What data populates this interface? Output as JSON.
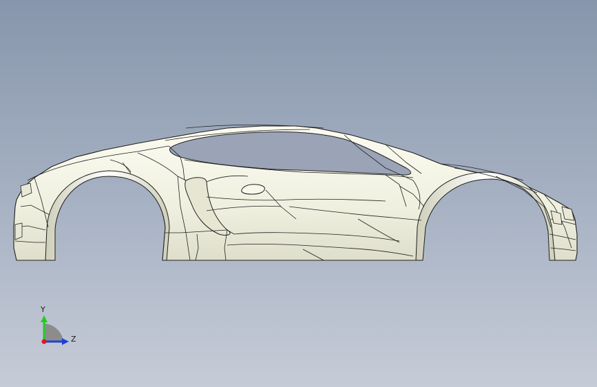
{
  "viewport": {
    "background_top": "#8796ac",
    "background_bottom": "#c6ccd7"
  },
  "model": {
    "surface_color": "#f2f2e4",
    "edge_color": "#1e1e1e",
    "shadow_color": "#b9baa6"
  },
  "triad": {
    "y_label": "Y",
    "z_label": "Z",
    "y_color": "#22cc22",
    "z_color": "#1e3fd8",
    "x_color": "#e01818"
  }
}
